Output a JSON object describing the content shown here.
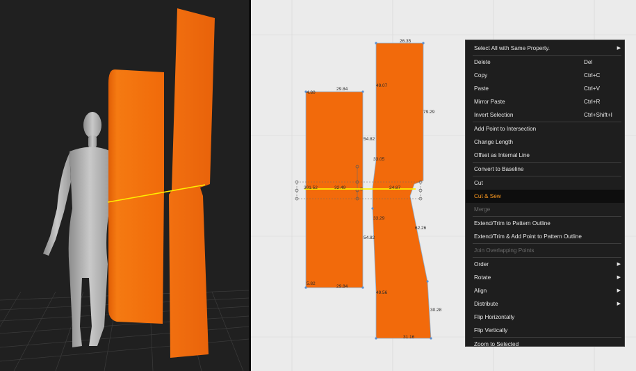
{
  "viewport_2d": {
    "measurements": {
      "left_top": "29.84",
      "left_top_corner": "4.80",
      "left_right_upper": "54.82",
      "left_cut": "301.52",
      "left_cut_mid": "32.49",
      "left_right_lower": "54.82",
      "left_bottom_corner": "5.82",
      "left_bottom": "29.84",
      "right_top": "26.35",
      "right_left_upper": "49.07",
      "right_right_upper": "79.29",
      "right_left_mid_upper": "33.05",
      "right_cut": "24.87",
      "right_left_mid_lower": "33.29",
      "right_right_lower": "62.26",
      "right_left_lower": "49.56",
      "right_right_bottom": "30.28",
      "right_bottom": "31.16"
    }
  },
  "context_menu": {
    "items": [
      {
        "label": "Select All with Same Property.",
        "shortcut": "",
        "submenu": true
      },
      {
        "label": "Delete",
        "shortcut": "Del"
      },
      {
        "label": "Copy",
        "shortcut": "Ctrl+C"
      },
      {
        "label": "Paste",
        "shortcut": "Ctrl+V"
      },
      {
        "label": "Mirror Paste",
        "shortcut": "Ctrl+R"
      },
      {
        "label": "Invert Selection",
        "shortcut": "Ctrl+Shift+I"
      },
      {
        "label": "Add Point to Intersection",
        "shortcut": ""
      },
      {
        "label": "Change Length",
        "shortcut": ""
      },
      {
        "label": "Offset as Internal Line",
        "shortcut": ""
      },
      {
        "label": "Convert to Baseline",
        "shortcut": ""
      },
      {
        "label": "Cut",
        "shortcut": ""
      },
      {
        "label": "Cut & Sew",
        "shortcut": "",
        "highlighted": true
      },
      {
        "label": "Merge",
        "shortcut": "",
        "disabled": true
      },
      {
        "label": "Extend/Trim to Pattern Outline",
        "shortcut": ""
      },
      {
        "label": "Extend/Trim & Add Point to Pattern Outline",
        "shortcut": ""
      },
      {
        "label": "Join Overlapping Points",
        "shortcut": "",
        "disabled": true
      },
      {
        "label": "Order",
        "shortcut": "",
        "submenu": true
      },
      {
        "label": "Rotate",
        "shortcut": "",
        "submenu": true
      },
      {
        "label": "Align",
        "shortcut": "",
        "submenu": true
      },
      {
        "label": "Distribute",
        "shortcut": "",
        "submenu": true
      },
      {
        "label": "Flip Horizontally",
        "shortcut": ""
      },
      {
        "label": "Flip Vertically",
        "shortcut": ""
      },
      {
        "label": "Zoom to Selected",
        "shortcut": ""
      }
    ]
  },
  "colors": {
    "fabric": "#f26a0b",
    "cut_line": "#ffee00",
    "menu_highlight_text": "#ff9a1f",
    "canvas_2d": "#ebebeb",
    "canvas_3d": "#202020"
  }
}
